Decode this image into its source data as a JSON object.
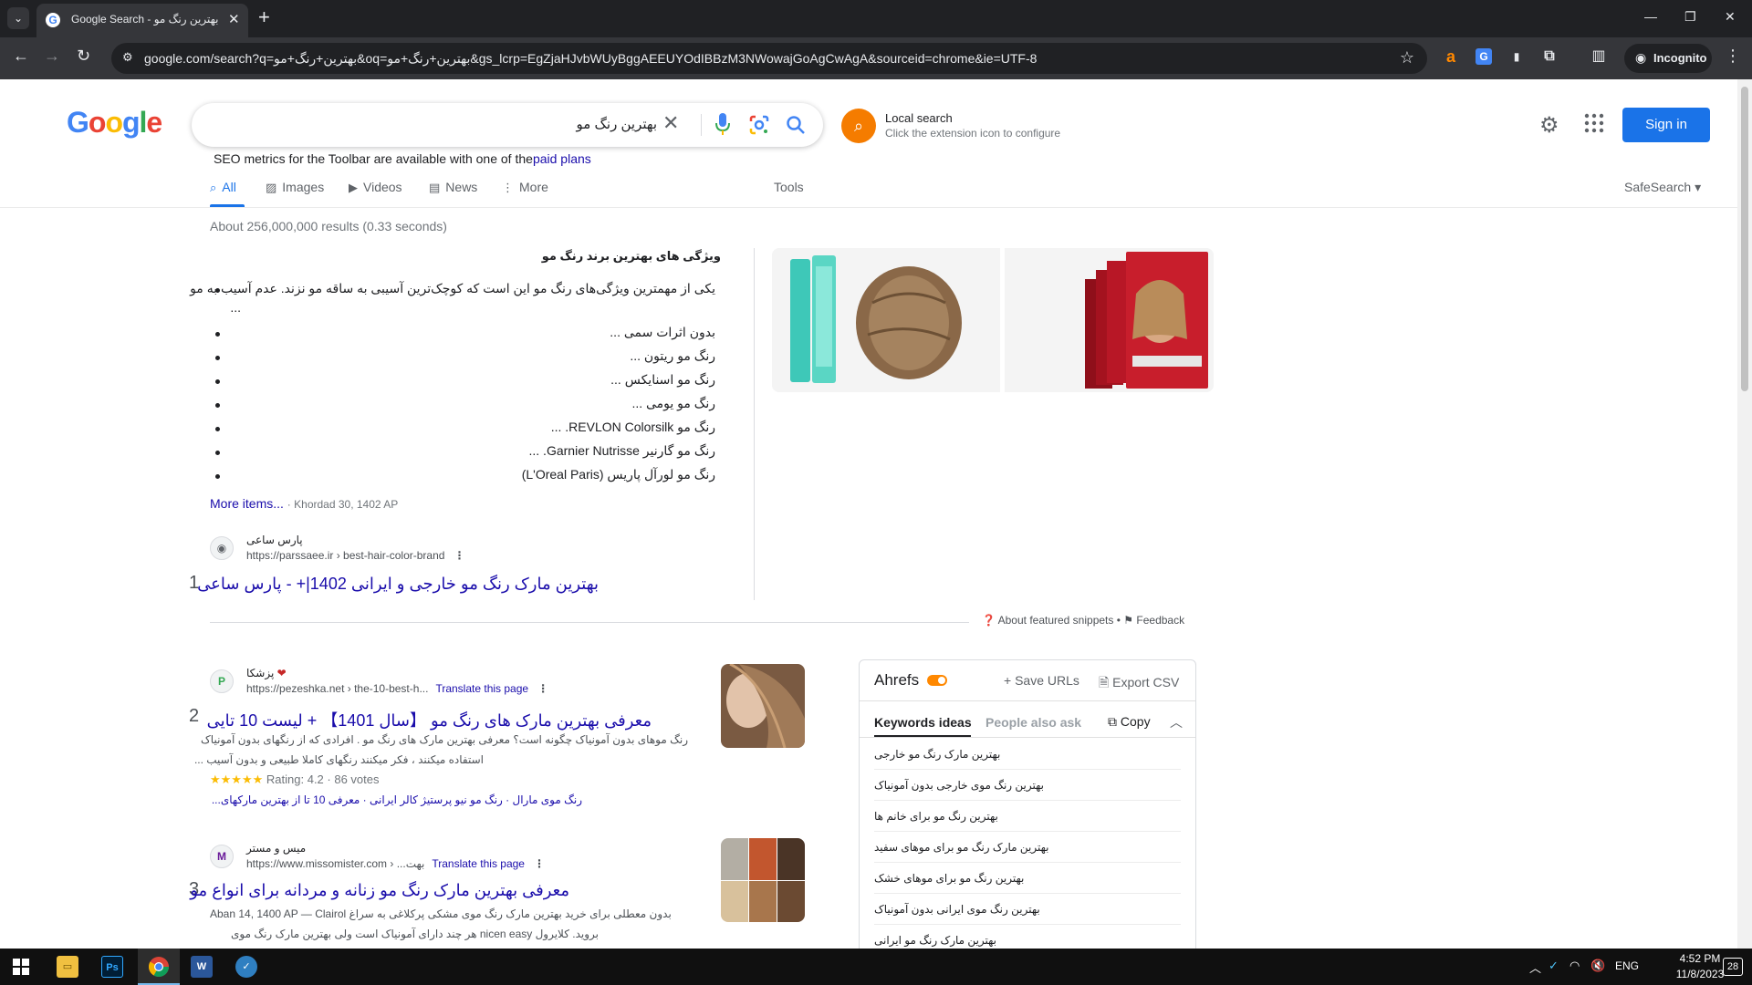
{
  "browser": {
    "tab_title": "Google Search - بهترین رنگ مو",
    "url": "google.com/search?q=بهترین+رنگ+مو&oq=بهترین+رنگ+مو&gs_lcrp=EgZjaHJvbWUyBggAEEUYOdIBBzM3NWowajGoAgCwAgA&sourceid=chrome&ie=UTF-8",
    "incognito_label": "Incognito"
  },
  "google": {
    "logo": [
      "G",
      "o",
      "o",
      "g",
      "l",
      "e"
    ],
    "logo_colors": [
      "#4285f4",
      "#ea4335",
      "#fbbc05",
      "#4285f4",
      "#34a853",
      "#ea4335"
    ],
    "query": "بهترین رنگ مو",
    "local_search_title": "Local search",
    "local_search_sub": "Click the extension icon to configure",
    "signin": "Sign in",
    "seo_msg": "SEO metrics for the Toolbar are available with one of the",
    "seo_link": "paid plans"
  },
  "tabs": {
    "all": "All",
    "images": "Images",
    "videos": "Videos",
    "news": "News",
    "more": "More",
    "tools": "Tools",
    "safesearch": "SafeSearch"
  },
  "results": {
    "stats": "About 256,000,000 results (0.33 seconds)",
    "snippet": {
      "heading": "ویژگی های بهترین برند رنگ مو",
      "items": [
        "یکی از مهمترین ویژگی‌های رنگ مو این است که کوچک‌ترین آسیبی به ساقه مو نزند. عدم آسیب به مو",
        "...",
        "بدون اثرات سمی ...",
        "رنگ مو ریتون ...",
        "رنگ مو اسنایکس ...",
        "رنگ مو یومی ...",
        "رنگ مو REVLON Colorsilk. ...",
        "رنگ مو گارنیر Garnier Nutrisse. ...",
        "رنگ مو لورآل پاریس (L'Oreal Paris)"
      ],
      "more_items": "More items...",
      "date": "Khordad 30, 1402 AP",
      "site_name": "پارس ساعی",
      "site_url": "https://parssaee.ir › best-hair-color-brand",
      "title": "بهترین مارک رنگ مو خارجی و ایرانی 1402|+ - پارس ساعی",
      "num": "1",
      "about": "About featured snippets",
      "feedback": "Feedback"
    },
    "r2": {
      "num": "2",
      "favicon": "P",
      "site_name": "پزشکا",
      "site_url": "https://pezeshka.net › the-10-best-h...",
      "translate": "Translate this page",
      "title": "معرفی بهترین مارک های رنگ مو 【سال 1401】 + لیست 10 تایی",
      "snip1": "رنگ موهای بدون آمونیاک چگونه است؟ معرفی بهترین مارک های رنگ مو . افرادی که از رنگهای بدون آمونیاک",
      "snip2": "استفاده میکنند ، فکر میکنند رنگهای کاملا طبیعی و بدون آسیب ...",
      "stars": "★★★★★",
      "rating": "Rating: 4.2 · 86 votes",
      "sitelinks": "رنگ موی مارال · رنگ مو نیو پرستیژ کالر ایرانی · معرفی 10 تا از بهترین مارکهای..."
    },
    "r3": {
      "num": "3",
      "favicon": "M",
      "site_name": "میس و مستر",
      "site_url": "https://www.missomister.com › ...بهت",
      "translate": "Translate this page",
      "title": "معرفی بهترین مارک رنگ مو زنانه و مردانه برای انواع مو",
      "snip1": "Aban 14, 1400 AP — Clairol بدون معطلی برای خرید بهترین مارک رنگ موی مشکی پرکلاغی به سراغ",
      "snip2": "بروید. کلایرول nicen easy هر چند دارای آمونیاک است ولی بهترین مارک رنگ موی"
    }
  },
  "ahrefs": {
    "title": "Ahrefs",
    "save": "Save URLs",
    "export": "Export CSV",
    "tab1": "Keywords ideas",
    "tab2": "People also ask",
    "copy": "Copy",
    "keywords": [
      "بهترین مارک رنگ مو خارجی",
      "بهترین رنگ موی خارجی بدون آمونیاک",
      "بهترین رنگ مو برای خانم ها",
      "بهترین مارک رنگ مو برای موهای سفید",
      "بهترین رنگ مو برای موهای خشک",
      "بهترین رنگ موی ایرانی بدون آمونیاک",
      "بهترین مارک رنگ مو ایرانی"
    ]
  },
  "taskbar": {
    "lang": "ENG",
    "time": "4:52 PM",
    "date": "11/8/2023",
    "notifications": "28"
  }
}
